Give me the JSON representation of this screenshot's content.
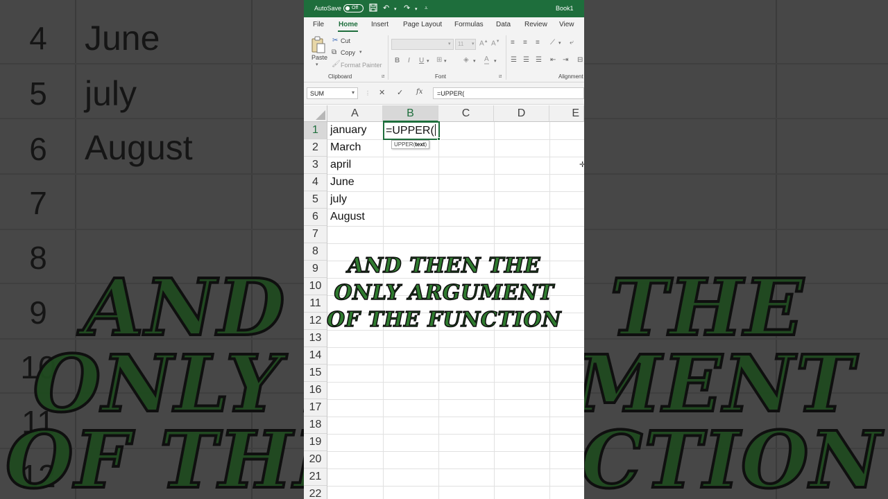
{
  "titlebar": {
    "autosave_label": "AutoSave",
    "autosave_state": "Off",
    "workbook": "Book1"
  },
  "menu": {
    "tabs": [
      "File",
      "Home",
      "Insert",
      "Page Layout",
      "Formulas",
      "Data",
      "Review",
      "View"
    ],
    "active_tab": "Home"
  },
  "ribbon": {
    "paste": "Paste",
    "cut": "Cut",
    "copy": "Copy",
    "format_painter": "Format Painter",
    "clipboard_group": "Clipboard",
    "font_group": "Font",
    "alignment_group": "Alignment",
    "font_size": "11",
    "bold": "B",
    "italic": "I",
    "underline": "U"
  },
  "formula_bar": {
    "name_box": "SUM",
    "formula": "=UPPER("
  },
  "sheet": {
    "columns": [
      "A",
      "B",
      "C",
      "D",
      "E"
    ],
    "selected_column": "B",
    "rows": [
      "1",
      "2",
      "3",
      "4",
      "5",
      "6",
      "7",
      "8",
      "9",
      "10",
      "11",
      "12",
      "13",
      "14",
      "15",
      "16",
      "17",
      "18",
      "19",
      "20",
      "21",
      "22"
    ],
    "selected_row": "1",
    "column_a": [
      "january",
      "March",
      "april",
      "June",
      "july",
      "August"
    ],
    "active_cell": {
      "ref": "B1",
      "text": "=UPPER("
    },
    "tooltip_fn": "UPPER(",
    "tooltip_arg": "text",
    "tooltip_close": ")"
  },
  "caption": {
    "line1": "And then the",
    "line2": "only argument",
    "line3": "of the function"
  },
  "background": {
    "rows": [
      "4",
      "5",
      "6",
      "7",
      "8",
      "9",
      "10",
      "11",
      "12"
    ],
    "cells": [
      "June",
      "july",
      "August"
    ]
  },
  "colors": {
    "excel_green": "#1e6e3c",
    "caption_green": "#2f7a2f"
  }
}
